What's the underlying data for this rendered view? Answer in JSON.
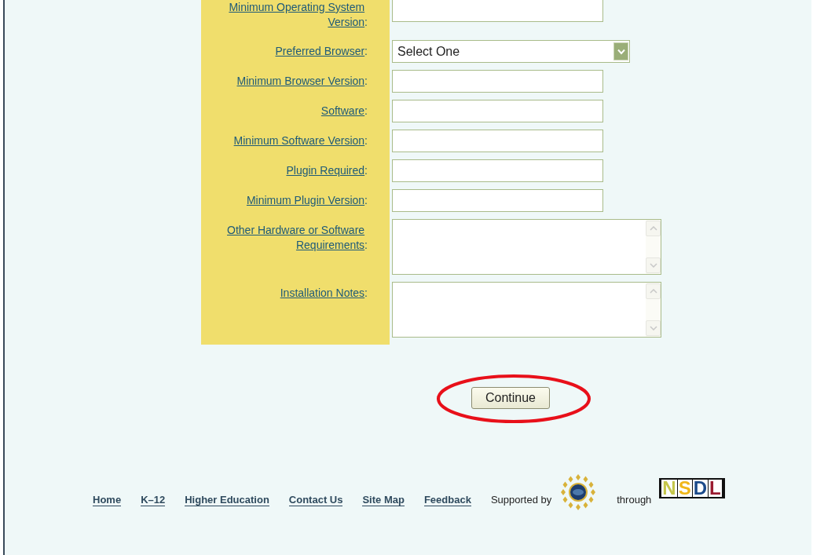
{
  "form": {
    "fields": [
      {
        "label": "Minimum Operating System Version",
        "kind": "text",
        "clipped": true
      },
      {
        "label": "Preferred Browser",
        "kind": "select",
        "value": "Select One"
      },
      {
        "label": "Minimum Browser Version",
        "kind": "text"
      },
      {
        "label": "Software",
        "kind": "text"
      },
      {
        "label": "Minimum Software Version",
        "kind": "text"
      },
      {
        "label": "Plugin Required",
        "kind": "text"
      },
      {
        "label": "Minimum Plugin Version",
        "kind": "text"
      },
      {
        "label": "Other Hardware or Software Requirements",
        "kind": "textarea"
      },
      {
        "label": "Installation Notes",
        "kind": "textarea"
      }
    ],
    "colon": ":",
    "submit": "Continue",
    "submit_highlighted": true
  },
  "footer": {
    "links": [
      "Home",
      "K–12",
      "Higher Education",
      "Contact Us",
      "Site Map",
      "Feedback"
    ],
    "supported_by": "Supported by",
    "through": "through",
    "logo": "NSDL"
  }
}
